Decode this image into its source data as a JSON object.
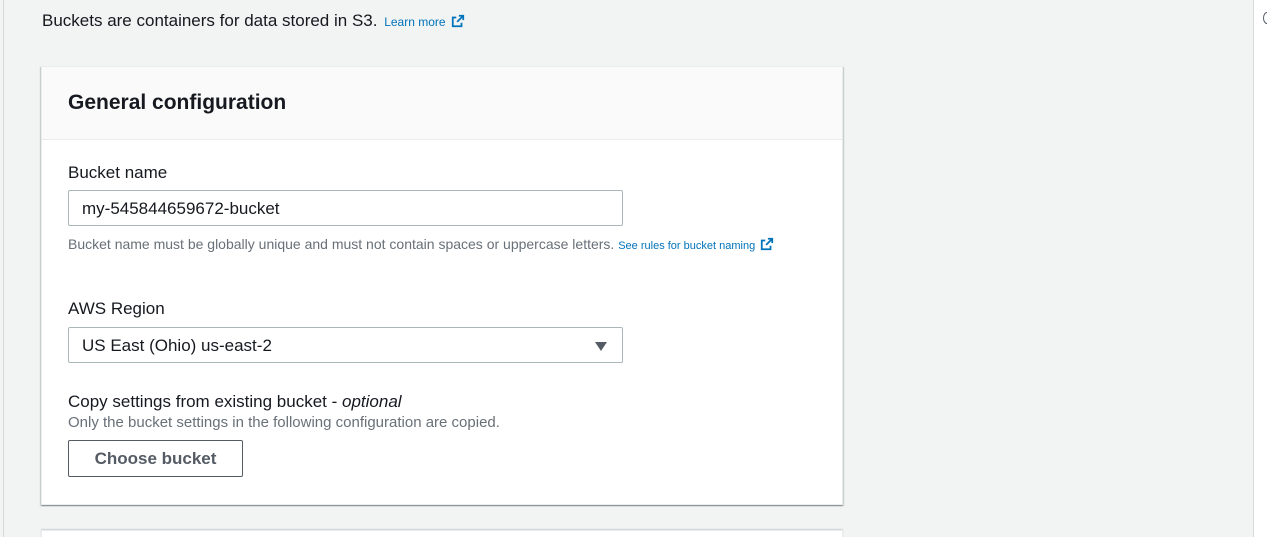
{
  "intro": {
    "text": "Buckets are containers for data stored in S3.",
    "learn_more": "Learn more",
    "learn_more_icon": "external-link-icon"
  },
  "general_config": {
    "title": "General configuration",
    "bucket_name": {
      "label": "Bucket name",
      "value": "my-545844659672-bucket",
      "hint": "Bucket name must be globally unique and must not contain spaces or uppercase letters.",
      "hint_link": "See rules for bucket naming",
      "hint_link_icon": "external-link-icon"
    },
    "region": {
      "label": "AWS Region",
      "selected": "US East (Ohio) us-east-2",
      "caret_icon": "caret-down-icon"
    },
    "copy_settings": {
      "label": "Copy settings from existing bucket - ",
      "label_optional": "optional",
      "description": "Only the bucket settings in the following configuration are copied.",
      "button": "Choose bucket"
    }
  },
  "colors": {
    "link": "#0073bb",
    "text": "#16191f",
    "muted": "#687078",
    "background": "#f2f3f3"
  }
}
